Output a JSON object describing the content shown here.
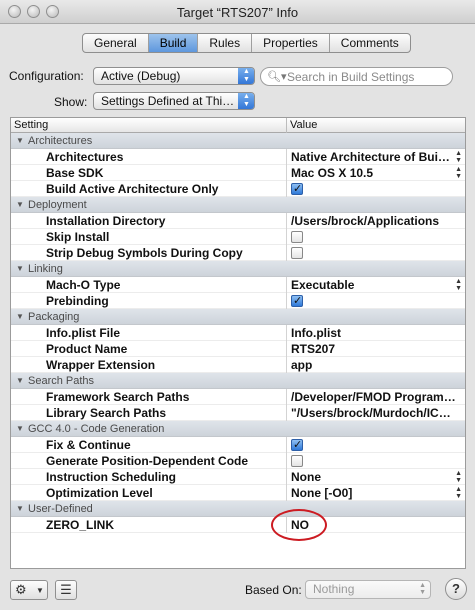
{
  "window": {
    "title": "Target “RTS207” Info"
  },
  "tabs": [
    {
      "label": "General",
      "active": false
    },
    {
      "label": "Build",
      "active": true
    },
    {
      "label": "Rules",
      "active": false
    },
    {
      "label": "Properties",
      "active": false
    },
    {
      "label": "Comments",
      "active": false
    }
  ],
  "config": {
    "configuration_label": "Configuration:",
    "configuration_value": "Active (Debug)",
    "show_label": "Show:",
    "show_value": "Settings Defined at Thi…",
    "search_placeholder": "Search in Build Settings"
  },
  "table": {
    "col_setting": "Setting",
    "col_value": "Value",
    "groups": [
      {
        "title": "Architectures",
        "rows": [
          {
            "name": "Architectures",
            "value": "Native Architecture of Bui…",
            "kind": "popup"
          },
          {
            "name": "Base SDK",
            "value": "Mac OS X 10.5",
            "kind": "popup"
          },
          {
            "name": "Build Active Architecture Only",
            "checked": true,
            "kind": "check"
          }
        ]
      },
      {
        "title": "Deployment",
        "rows": [
          {
            "name": "Installation Directory",
            "value": "/Users/brock/Applications",
            "kind": "text"
          },
          {
            "name": "Skip Install",
            "checked": false,
            "kind": "check"
          },
          {
            "name": "Strip Debug Symbols During Copy",
            "checked": false,
            "kind": "check"
          }
        ]
      },
      {
        "title": "Linking",
        "rows": [
          {
            "name": "Mach-O Type",
            "value": "Executable",
            "kind": "popup"
          },
          {
            "name": "Prebinding",
            "checked": true,
            "kind": "check"
          }
        ]
      },
      {
        "title": "Packaging",
        "rows": [
          {
            "name": "Info.plist File",
            "value": "Info.plist",
            "kind": "text"
          },
          {
            "name": "Product Name",
            "value": "RTS207",
            "kind": "text"
          },
          {
            "name": "Wrapper Extension",
            "value": "app",
            "kind": "text"
          }
        ]
      },
      {
        "title": "Search Paths",
        "rows": [
          {
            "name": "Framework Search Paths",
            "value": "/Developer/FMOD Program…",
            "kind": "text"
          },
          {
            "name": "Library Search Paths",
            "value": " \"/Users/brock/Murdoch/IC…",
            "kind": "text"
          }
        ]
      },
      {
        "title": "GCC 4.0 - Code Generation",
        "rows": [
          {
            "name": "Fix & Continue",
            "checked": true,
            "kind": "check"
          },
          {
            "name": "Generate Position-Dependent Code",
            "checked": false,
            "kind": "check"
          },
          {
            "name": "Instruction Scheduling",
            "value": "None",
            "kind": "popup"
          },
          {
            "name": "Optimization Level",
            "value": "None [-O0]",
            "kind": "popup"
          }
        ]
      },
      {
        "title": "User-Defined",
        "rows": [
          {
            "name": "ZERO_LINK",
            "value": "NO",
            "kind": "text"
          }
        ]
      }
    ]
  },
  "bottom": {
    "based_on_label": "Based On:",
    "based_on_value": "Nothing",
    "help_label": "?"
  },
  "icons": {
    "gear": "gear-icon",
    "list": "list-icon",
    "search": "search-icon",
    "disclosure": "disclosure-triangle-icon",
    "help": "help-icon"
  },
  "colors": {
    "selected_tab": "#5e97dd",
    "annotation_circle": "#cc1b22",
    "group_header": "#d5dae0"
  }
}
